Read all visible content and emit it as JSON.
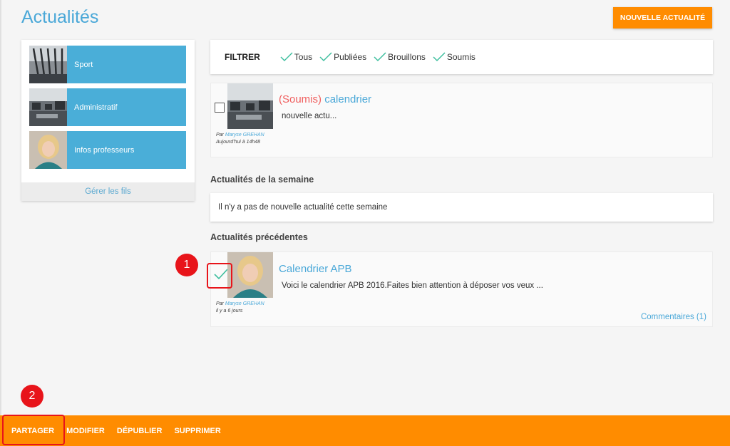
{
  "header": {
    "title": "Actualités",
    "new_button": "NOUVELLE ACTUALITÉ"
  },
  "sidebar": {
    "threads": [
      {
        "label": "Sport",
        "icon": "building-photo"
      },
      {
        "label": "Administratif",
        "icon": "office-photo"
      },
      {
        "label": "Infos professeurs",
        "icon": "portrait-photo"
      }
    ],
    "manage_link": "Gérer les fils"
  },
  "filter": {
    "label": "FILTRER",
    "options": [
      "Tous",
      "Publiées",
      "Brouillons",
      "Soumis"
    ]
  },
  "news_current": {
    "status": "(Soumis)",
    "title": "calendrier",
    "text": "nouvelle actu...",
    "by": "Par",
    "author": "Maryse GREHAN",
    "date": "Aujourd'hui à 14h48"
  },
  "week": {
    "title": "Actualités de la semaine",
    "empty": "Il n'y a pas de nouvelle actualité cette semaine"
  },
  "previous": {
    "title": "Actualités précédentes",
    "item": {
      "title": "Calendrier APB",
      "text": "Voici le calendrier APB 2016.Faites bien attention à déposer vos veux ...",
      "by": "Par",
      "author": "Maryse GREHAN",
      "date": "il y a 6 jours",
      "comments": "Commentaires (1)"
    }
  },
  "annotations": {
    "one": "1",
    "two": "2"
  },
  "actions": [
    "PARTAGER",
    "MODIFIER",
    "DÉPUBLIER",
    "SUPPRIMER"
  ],
  "colors": {
    "accent": "#4aa8d8",
    "orange": "#ff8c00",
    "status_red": "#f06060",
    "highlight": "#e8141a",
    "check": "#3fbf9f"
  }
}
